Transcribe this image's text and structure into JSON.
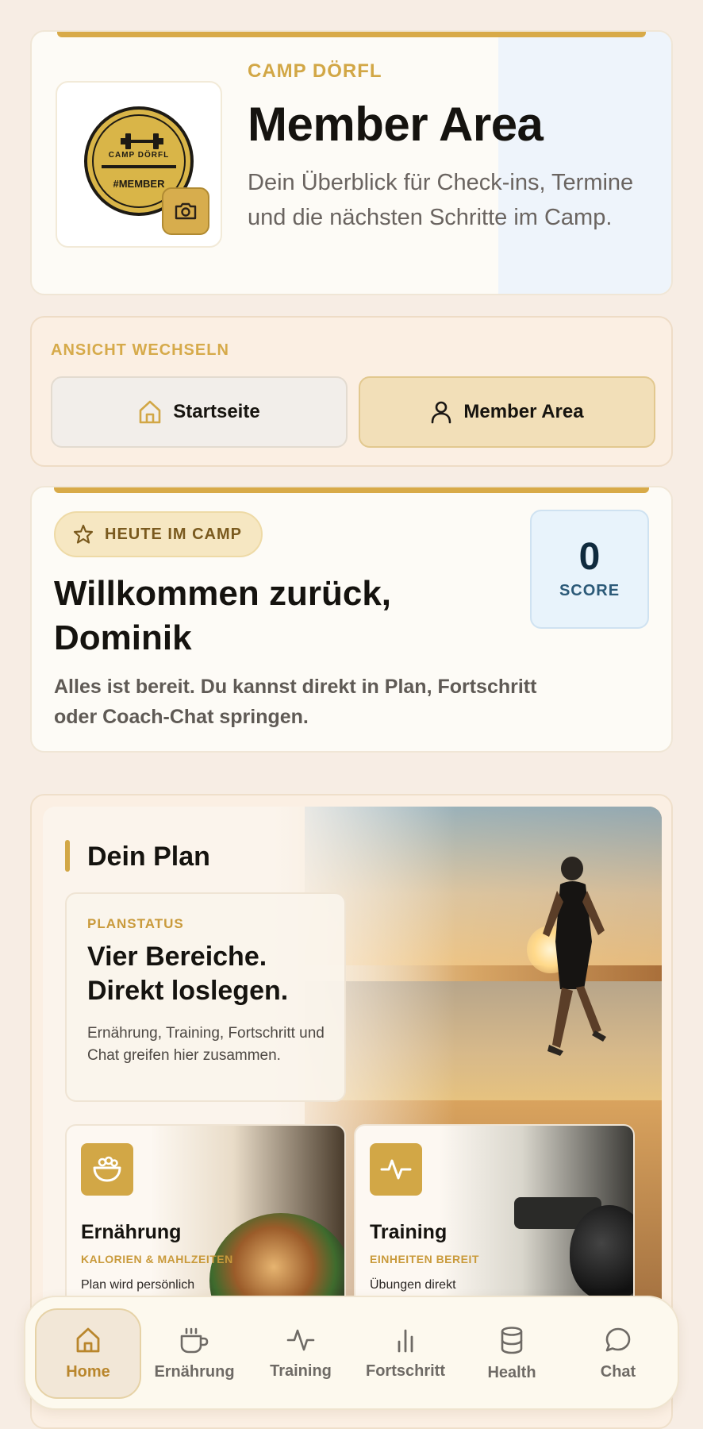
{
  "header": {
    "brand": "CAMP DÖRFL",
    "title": "Member Area",
    "description": "Dein Überblick für Check-ins, Termine und die nächsten Schritte im Camp.",
    "logo": {
      "top_text": "CAMP DÖRFL",
      "bottom_text": "#MEMBER"
    },
    "camera_icon": "camera-icon"
  },
  "view_switch": {
    "label": "ANSICHT WECHSELN",
    "options": [
      {
        "label": "Startseite",
        "icon": "home-icon",
        "selected": false
      },
      {
        "label": "Member Area",
        "icon": "user-icon",
        "selected": true
      }
    ]
  },
  "welcome": {
    "pill": "HEUTE IM CAMP",
    "title": "Willkommen zurück, Dominik",
    "description": "Alles ist bereit. Du kannst direkt in Plan, Fortschritt oder Coach-Chat springen.",
    "score_value": "0",
    "score_label": "SCORE"
  },
  "plan": {
    "heading": "Dein Plan",
    "status_kicker": "PLANSTATUS",
    "status_title": "Vier Bereiche. Direkt loslegen.",
    "status_description": "Ernährung, Training, Fortschritt und Chat greifen hier zusammen.",
    "tiles": [
      {
        "title": "Ernährung",
        "kicker": "KALORIEN & MAHLZEITEN",
        "description": "Plan wird persönlich",
        "icon": "salad-bowl-icon"
      },
      {
        "title": "Training",
        "kicker": "EINHEITEN BEREIT",
        "description": "Übungen direkt",
        "icon": "activity-icon"
      }
    ]
  },
  "bottom_nav": {
    "items": [
      {
        "label": "Home",
        "icon": "home-icon",
        "active": true
      },
      {
        "label": "Ernährung",
        "icon": "coffee-cup-icon",
        "active": false
      },
      {
        "label": "Training",
        "icon": "activity-icon",
        "active": false
      },
      {
        "label": "Fortschritt",
        "icon": "bar-chart-icon",
        "active": false
      },
      {
        "label": "Health",
        "icon": "database-icon",
        "active": false
      },
      {
        "label": "Chat",
        "icon": "chat-bubble-icon",
        "active": false
      }
    ]
  },
  "colors": {
    "accent": "#d2a746",
    "background": "#f7ede4",
    "card": "#fdfbf6",
    "score_bg": "#e8f3fb"
  }
}
